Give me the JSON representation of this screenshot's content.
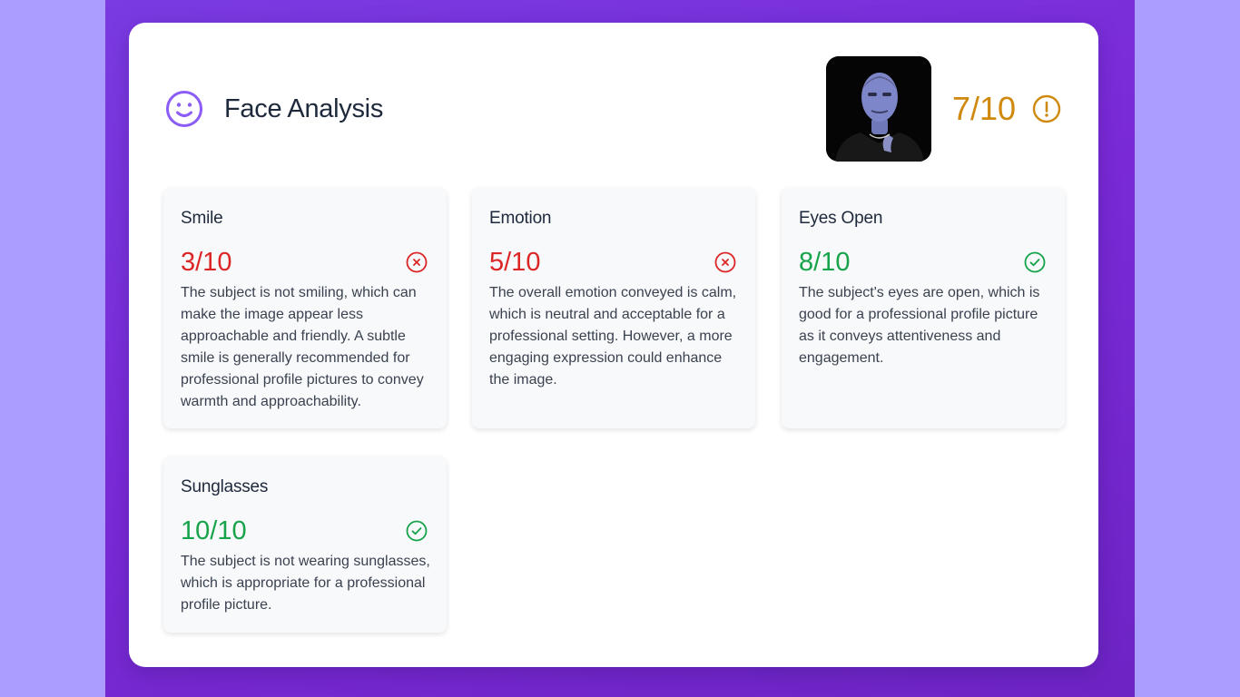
{
  "header": {
    "title": "Face Analysis",
    "icon": "smiley-face-icon",
    "overall_score": "7/10",
    "overall_status_icon": "warning-circle-icon",
    "accent_color": "#8b5cf6",
    "warning_color": "#cf8a0e"
  },
  "metrics": [
    {
      "title": "Smile",
      "score": "3/10",
      "status": "fail",
      "icon": "x-circle-icon",
      "description": "The subject is not smiling, which can make the image appear less approachable and friendly. A subtle smile is generally recommended for professional profile pictures to convey warmth and approachability."
    },
    {
      "title": "Emotion",
      "score": "5/10",
      "status": "fail",
      "icon": "x-circle-icon",
      "description": "The overall emotion conveyed is calm, which is neutral and acceptable for a professional setting. However, a more engaging expression could enhance the image."
    },
    {
      "title": "Eyes Open",
      "score": "8/10",
      "status": "pass",
      "icon": "check-circle-icon",
      "description": "The subject's eyes are open, which is good for a professional profile picture as it conveys attentiveness and engagement."
    },
    {
      "title": "Sunglasses",
      "score": "10/10",
      "status": "pass",
      "icon": "check-circle-icon",
      "description": "The subject is not wearing sunglasses, which is appropriate for a professional profile picture."
    }
  ],
  "colors": {
    "fail": "#dc2626",
    "pass": "#16a34a"
  }
}
